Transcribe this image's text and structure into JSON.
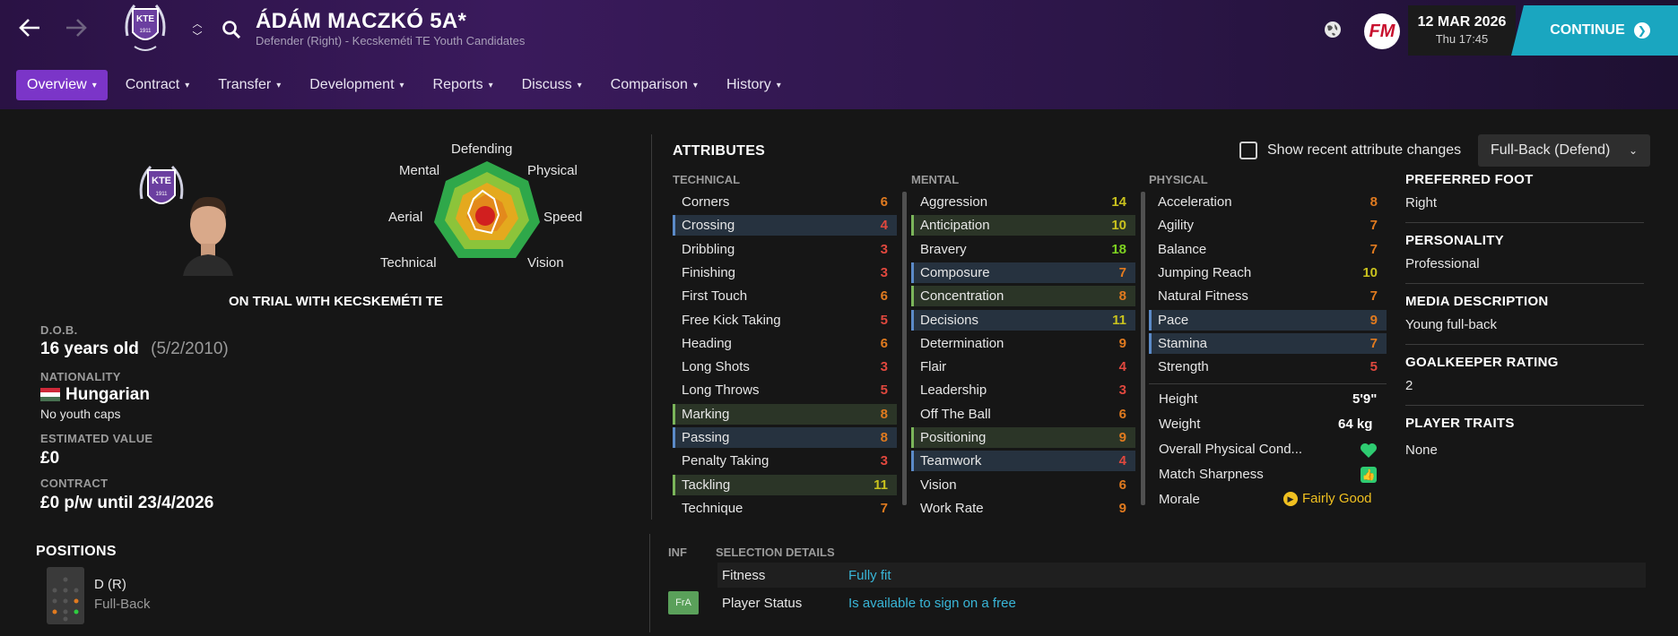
{
  "header": {
    "player_name": "ÁDÁM MACZKÓ 5A*",
    "subtitle": "Defender (Right) - Kecskeméti TE Youth Candidates",
    "club_badge_text": "KTE",
    "club_badge_year": "1911",
    "back_icon": "back-arrow-icon",
    "forward_icon": "forward-arrow-icon",
    "search_icon": "search-icon",
    "fm_logo_text": "FM",
    "date": "12 MAR 2026",
    "day_time": "Thu 17:45",
    "continue_label": "CONTINUE",
    "accent_color": "#1aa6c0"
  },
  "tabs": [
    {
      "label": "Overview",
      "active": true
    },
    {
      "label": "Contract"
    },
    {
      "label": "Transfer"
    },
    {
      "label": "Development"
    },
    {
      "label": "Reports"
    },
    {
      "label": "Discuss"
    },
    {
      "label": "Comparison"
    },
    {
      "label": "History"
    }
  ],
  "radar": {
    "labels": {
      "defending": "Defending",
      "physical": "Physical",
      "speed": "Speed",
      "vision": "Vision",
      "technical": "Technical",
      "aerial": "Aerial",
      "mental": "Mental"
    }
  },
  "trial_status": "ON TRIAL WITH KECSKEMÉTI TE",
  "info": {
    "dob_label": "D.O.B.",
    "age": "16 years old",
    "dob": "(5/2/2010)",
    "nationality_label": "NATIONALITY",
    "nationality": "Hungarian",
    "youth_caps": "No youth caps",
    "value_label": "ESTIMATED VALUE",
    "value": "£0",
    "contract_label": "CONTRACT",
    "contract": "£0 p/w until 23/4/2026"
  },
  "positions": {
    "title": "POSITIONS",
    "position": "D (R)",
    "role": "Full-Back"
  },
  "attributes": {
    "title": "ATTRIBUTES",
    "show_changes_label": "Show recent attribute changes",
    "role_dropdown": "Full-Back (Defend)",
    "technical_head": "TECHNICAL",
    "mental_head": "MENTAL",
    "physical_head": "PHYSICAL",
    "technical": [
      {
        "name": "Corners",
        "value": "6",
        "hl": ""
      },
      {
        "name": "Crossing",
        "value": "4",
        "hl": "blue"
      },
      {
        "name": "Dribbling",
        "value": "3",
        "hl": ""
      },
      {
        "name": "Finishing",
        "value": "3",
        "hl": ""
      },
      {
        "name": "First Touch",
        "value": "6",
        "hl": ""
      },
      {
        "name": "Free Kick Taking",
        "value": "5",
        "hl": ""
      },
      {
        "name": "Heading",
        "value": "6",
        "hl": ""
      },
      {
        "name": "Long Shots",
        "value": "3",
        "hl": ""
      },
      {
        "name": "Long Throws",
        "value": "5",
        "hl": ""
      },
      {
        "name": "Marking",
        "value": "8",
        "hl": "green"
      },
      {
        "name": "Passing",
        "value": "8",
        "hl": "blue"
      },
      {
        "name": "Penalty Taking",
        "value": "3",
        "hl": ""
      },
      {
        "name": "Tackling",
        "value": "11",
        "hl": "green"
      },
      {
        "name": "Technique",
        "value": "7",
        "hl": ""
      }
    ],
    "mental": [
      {
        "name": "Aggression",
        "value": "14",
        "hl": ""
      },
      {
        "name": "Anticipation",
        "value": "10",
        "hl": "green"
      },
      {
        "name": "Bravery",
        "value": "18",
        "hl": ""
      },
      {
        "name": "Composure",
        "value": "7",
        "hl": "blue"
      },
      {
        "name": "Concentration",
        "value": "8",
        "hl": "green"
      },
      {
        "name": "Decisions",
        "value": "11",
        "hl": "blue"
      },
      {
        "name": "Determination",
        "value": "9",
        "hl": ""
      },
      {
        "name": "Flair",
        "value": "4",
        "hl": ""
      },
      {
        "name": "Leadership",
        "value": "3",
        "hl": ""
      },
      {
        "name": "Off The Ball",
        "value": "6",
        "hl": ""
      },
      {
        "name": "Positioning",
        "value": "9",
        "hl": "green"
      },
      {
        "name": "Teamwork",
        "value": "4",
        "hl": "blue"
      },
      {
        "name": "Vision",
        "value": "6",
        "hl": ""
      },
      {
        "name": "Work Rate",
        "value": "9",
        "hl": ""
      }
    ],
    "physical": [
      {
        "name": "Acceleration",
        "value": "8",
        "hl": ""
      },
      {
        "name": "Agility",
        "value": "7",
        "hl": ""
      },
      {
        "name": "Balance",
        "value": "7",
        "hl": ""
      },
      {
        "name": "Jumping Reach",
        "value": "10",
        "hl": ""
      },
      {
        "name": "Natural Fitness",
        "value": "7",
        "hl": ""
      },
      {
        "name": "Pace",
        "value": "9",
        "hl": "blue"
      },
      {
        "name": "Stamina",
        "value": "7",
        "hl": "blue"
      },
      {
        "name": "Strength",
        "value": "5",
        "hl": ""
      }
    ],
    "extra": {
      "height_label": "Height",
      "height": "5'9\"",
      "weight_label": "Weight",
      "weight": "64 kg",
      "condition_label": "Overall Physical Cond...",
      "sharpness_label": "Match Sharpness",
      "morale_label": "Morale",
      "morale": "Fairly Good"
    }
  },
  "profile": {
    "foot_label": "PREFERRED FOOT",
    "foot": "Right",
    "personality_label": "PERSONALITY",
    "personality": "Professional",
    "media_label": "MEDIA DESCRIPTION",
    "media": "Young full-back",
    "gk_label": "GOALKEEPER RATING",
    "gk": "2",
    "traits_label": "PLAYER TRAITS",
    "traits": "None"
  },
  "selection": {
    "inf_head": "INF",
    "title": "SELECTION DETAILS",
    "fitness_label": "Fitness",
    "fitness": "Fully fit",
    "status_badge": "FrA",
    "status_label": "Player Status",
    "status": "Is available to sign on a free"
  },
  "colors": {
    "val_low": "#e0483e",
    "val_mid": "#e07a1f",
    "val_good": "#c9c21e",
    "val_high": "#7ed321",
    "link": "#39b6d8"
  }
}
